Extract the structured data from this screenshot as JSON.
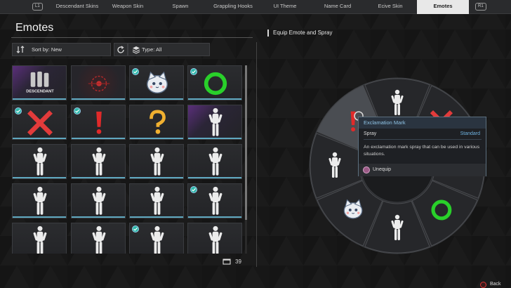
{
  "tabs": {
    "left_hint": "L1",
    "right_hint": "R1",
    "items": [
      {
        "label": "Descendant Skins",
        "active": false
      },
      {
        "label": "Weapon Skin",
        "active": false
      },
      {
        "label": "Spawn",
        "active": false
      },
      {
        "label": "Grappling Hooks",
        "active": false
      },
      {
        "label": "UI Theme",
        "active": false
      },
      {
        "label": "Name Card",
        "active": false
      },
      {
        "label": "Ecive Skin",
        "active": false
      },
      {
        "label": "Emotes",
        "active": true
      }
    ]
  },
  "left_panel": {
    "title": "Emotes",
    "sort_label": "Sort by: New",
    "type_label": "Type: All",
    "grid": [
      [
        {
          "icon": "descendant-logo-icon",
          "style": "purple",
          "equipped": false
        },
        {
          "icon": "target-spray-icon",
          "style": "red",
          "equipped": false
        },
        {
          "icon": "cat-sticker-icon",
          "style": "normal",
          "equipped": true
        },
        {
          "icon": "green-circle-icon",
          "style": "normal",
          "equipped": true
        }
      ],
      [
        {
          "icon": "red-x-icon",
          "style": "normal",
          "equipped": true
        },
        {
          "icon": "exclamation-mark-icon",
          "style": "normal",
          "equipped": true
        },
        {
          "icon": "question-mark-icon",
          "style": "normal",
          "equipped": false
        },
        {
          "icon": "pose-figure-icon",
          "style": "purple",
          "equipped": false
        }
      ],
      [
        {
          "icon": "pose-figure-icon",
          "style": "normal",
          "equipped": false
        },
        {
          "icon": "pose-figure-icon",
          "style": "normal",
          "equipped": false
        },
        {
          "icon": "pose-figure-icon",
          "style": "normal",
          "equipped": false
        },
        {
          "icon": "pose-figure-icon",
          "style": "normal",
          "equipped": false
        }
      ],
      [
        {
          "icon": "pose-figure-icon",
          "style": "normal",
          "equipped": false
        },
        {
          "icon": "pose-figure-icon",
          "style": "normal",
          "equipped": false
        },
        {
          "icon": "pose-figure-icon",
          "style": "normal",
          "equipped": false
        },
        {
          "icon": "pose-figure-icon",
          "style": "normal",
          "equipped": true
        }
      ],
      [
        {
          "icon": "pose-figure-icon",
          "style": "normal",
          "equipped": false
        },
        {
          "icon": "pose-figure-icon",
          "style": "normal",
          "equipped": false
        },
        {
          "icon": "pose-figure-icon",
          "style": "normal",
          "equipped": true
        },
        {
          "icon": "pose-figure-icon",
          "style": "normal",
          "equipped": false
        }
      ]
    ],
    "count": "39",
    "descendant_logo_text": "DESCENDANT"
  },
  "right_panel": {
    "title": "Equip Emote and Spray",
    "wheel_slots": [
      "pose-figure-icon",
      "red-x-icon",
      "empty-slot",
      "green-circle-icon",
      "pose-figure-icon",
      "cat-sticker-icon",
      "pose-figure-icon",
      "exclamation-mark-icon"
    ]
  },
  "tooltip": {
    "name": "Exclamation Mark",
    "type": "Spray",
    "grade": "Standard",
    "description": "An exclamation mark spray that can be used in various situations.",
    "action": "Unequip"
  },
  "footer": {
    "back_label": "Back"
  },
  "colors": {
    "accent_blue": "#5fa8c0",
    "equipped_badge": "#2fb8a8",
    "tooltip_title": "#8fc4e6",
    "grade_standard": "#6fb2e0",
    "back_button": "#dd3333"
  }
}
